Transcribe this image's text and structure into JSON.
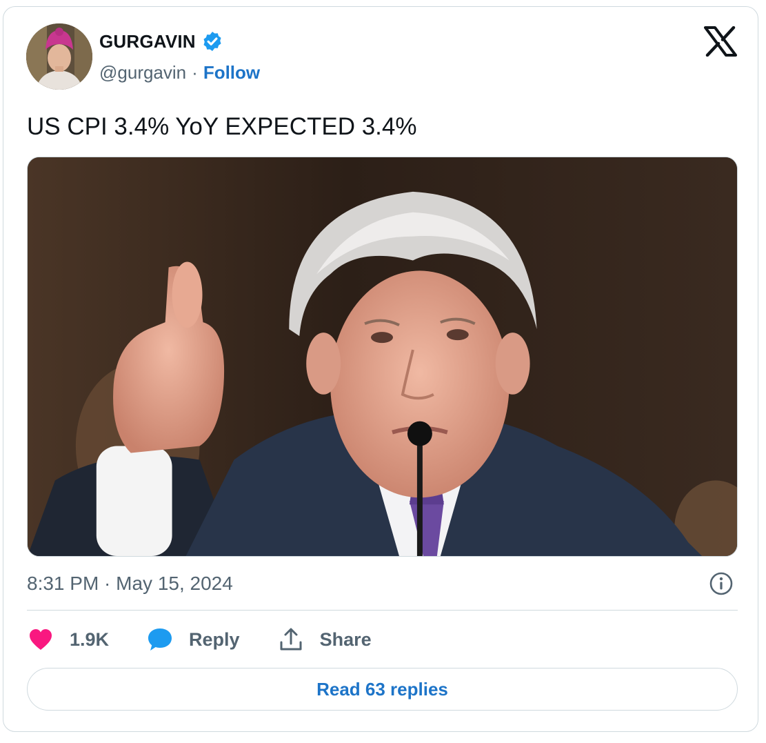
{
  "author": {
    "display_name": "GURGAVIN",
    "handle": "@gurgavin",
    "separator": "·",
    "follow_label": "Follow",
    "verified": true
  },
  "tweet": {
    "text": "US CPI 3.4% YoY EXPECTED 3.4%",
    "timestamp": "8:31 PM · May 15, 2024"
  },
  "actions": {
    "like_count": "1.9K",
    "reply_label": "Reply",
    "share_label": "Share"
  },
  "read_replies_label": "Read 63 replies",
  "colors": {
    "link": "#1d74c8",
    "secondary_text": "#536471",
    "like": "#f91880",
    "reply": "#1d9bf0",
    "border": "#cfd9de"
  },
  "icons": {
    "platform": "x-logo-icon",
    "verified": "verified-badge-icon",
    "info": "info-icon",
    "like": "heart-icon",
    "reply": "speech-bubble-icon",
    "share": "share-upload-icon"
  }
}
